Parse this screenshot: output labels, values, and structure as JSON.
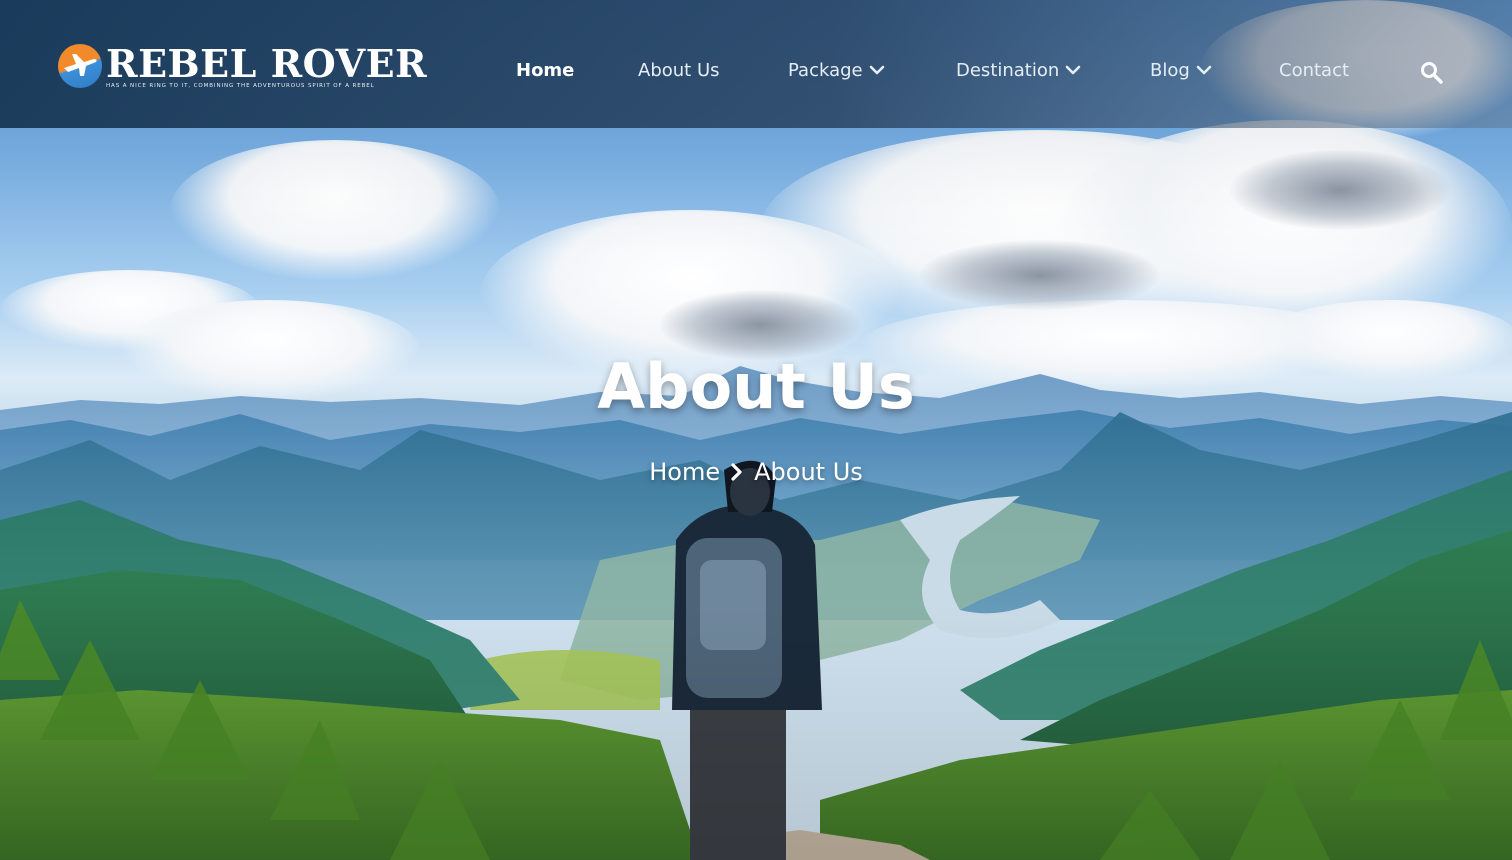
{
  "brand": {
    "name": "REBEL ROVER",
    "tagline": "HAS A NICE RING TO IT, COMBINING THE ADVENTUROUS SPIRIT OF A REBEL"
  },
  "nav": {
    "items": [
      {
        "label": "Home",
        "active": true,
        "dropdown": false
      },
      {
        "label": "About Us",
        "active": false,
        "dropdown": false
      },
      {
        "label": "Package",
        "active": false,
        "dropdown": true
      },
      {
        "label": "Destination",
        "active": false,
        "dropdown": true
      },
      {
        "label": "Blog",
        "active": false,
        "dropdown": true
      },
      {
        "label": "Contact",
        "active": false,
        "dropdown": false
      }
    ],
    "search_icon": "search-icon"
  },
  "hero": {
    "title": "About Us",
    "breadcrumb": [
      "Home",
      "About Us"
    ],
    "separator_icon": "chevron-right-icon"
  },
  "colors": {
    "accent_orange": "#f08a2a",
    "accent_blue": "#2e7bc6",
    "text": "#ffffff"
  }
}
